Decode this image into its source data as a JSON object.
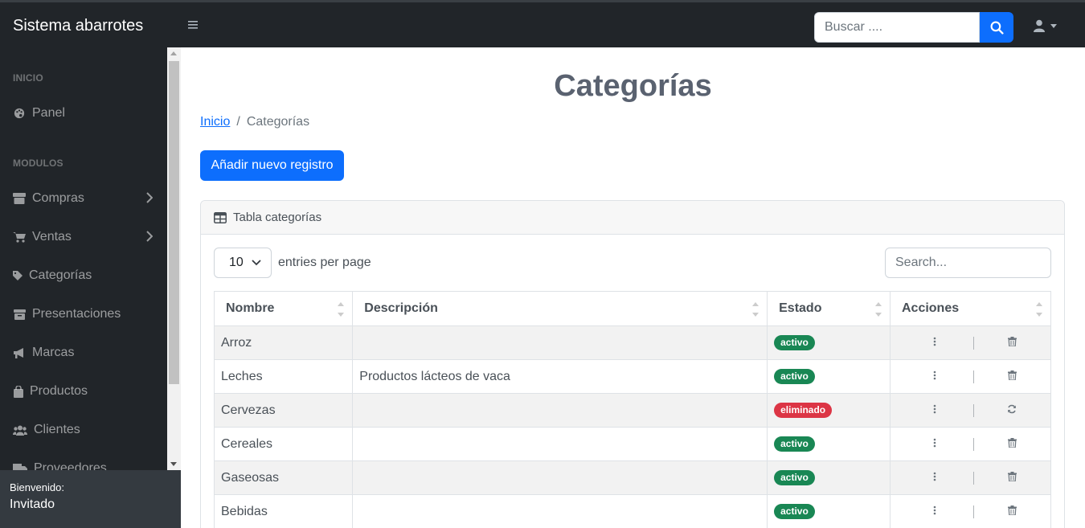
{
  "app": {
    "brand": "Sistema abarrotes"
  },
  "topbar": {
    "search_placeholder": "Buscar ...."
  },
  "sidebar": {
    "heading_inicio": "INICIO",
    "heading_modulos": "MODULOS",
    "items": [
      {
        "label": "Panel",
        "icon": "palette-icon"
      },
      {
        "label": "Compras",
        "icon": "store-icon"
      },
      {
        "label": "Ventas",
        "icon": "cart-icon"
      },
      {
        "label": "Categorías",
        "icon": "tag-icon"
      },
      {
        "label": "Presentaciones",
        "icon": "box-archive-icon"
      },
      {
        "label": "Marcas",
        "icon": "bullhorn-icon"
      },
      {
        "label": "Productos",
        "icon": "shopping-bag-icon"
      },
      {
        "label": "Clientes",
        "icon": "users-icon"
      },
      {
        "label": "Proveedores",
        "icon": "truck-icon"
      }
    ],
    "footer_small": "Bienvenido:",
    "footer_name": "Invitado"
  },
  "main": {
    "title": "Categorías",
    "breadcrumb": {
      "home": "Inicio",
      "current": "Categorías",
      "separator": "/"
    },
    "add_button": "Añadir nuevo registro",
    "card_title": "Tabla categorías",
    "per_page_value": "10",
    "per_page_label": "entries per page",
    "search_placeholder": "Search...",
    "columns": [
      "Nombre",
      "Descripción",
      "Estado",
      "Acciones"
    ],
    "rows": [
      {
        "nombre": "Arroz",
        "descripcion": "",
        "estado": "activo",
        "action2": "trash-icon"
      },
      {
        "nombre": "Leches",
        "descripcion": "Productos lácteos de vaca",
        "estado": "activo",
        "action2": "trash-icon"
      },
      {
        "nombre": "Cervezas",
        "descripcion": "",
        "estado": "eliminado",
        "action2": "refresh-icon"
      },
      {
        "nombre": "Cereales",
        "descripcion": "",
        "estado": "activo",
        "action2": "trash-icon"
      },
      {
        "nombre": "Gaseosas",
        "descripcion": "",
        "estado": "activo",
        "action2": "trash-icon"
      },
      {
        "nombre": "Bebidas",
        "descripcion": "",
        "estado": "activo",
        "action2": "trash-icon"
      }
    ]
  },
  "colors": {
    "primary": "#0d6efd",
    "dark": "#212529",
    "success": "#198754",
    "danger": "#dc3545"
  }
}
